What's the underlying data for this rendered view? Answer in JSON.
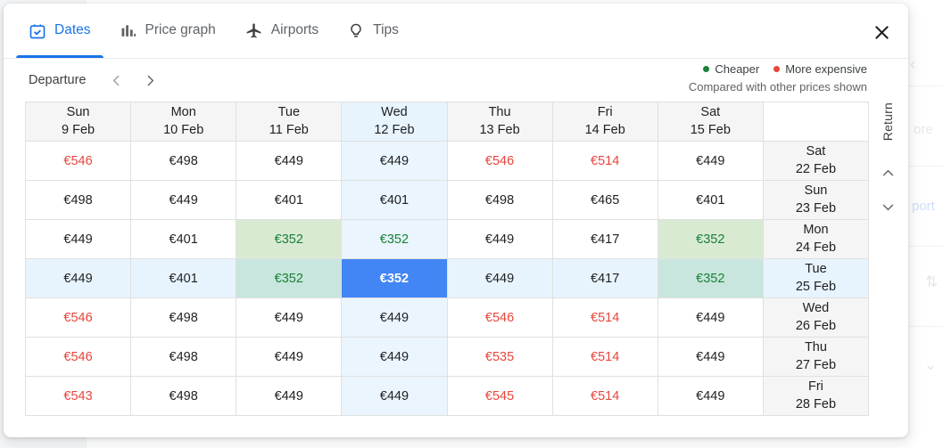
{
  "tabs": [
    {
      "label": "Dates",
      "icon": "calendar-check-icon",
      "active": true
    },
    {
      "label": "Price graph",
      "icon": "bar-chart-icon",
      "active": false
    },
    {
      "label": "Airports",
      "icon": "airplane-icon",
      "active": false
    },
    {
      "label": "Tips",
      "icon": "lightbulb-icon",
      "active": false
    }
  ],
  "close_label": "✕",
  "subheader": {
    "departure_label": "Departure",
    "prev_label": "‹",
    "next_label": "›"
  },
  "legend": {
    "cheaper_label": "Cheaper",
    "expensive_label": "More expensive",
    "note": "Compared with other prices shown",
    "cheaper_color": "#188038",
    "expensive_color": "#e8453c"
  },
  "return_rail": {
    "label": "Return",
    "up_label": "⌃",
    "down_label": "⌄"
  },
  "grid": {
    "corner_label": "",
    "columns": [
      {
        "day": "Sun",
        "date": "9 Feb",
        "highlight": false
      },
      {
        "day": "Mon",
        "date": "10 Feb",
        "highlight": false
      },
      {
        "day": "Tue",
        "date": "11 Feb",
        "highlight": false
      },
      {
        "day": "Wed",
        "date": "12 Feb",
        "highlight": true
      },
      {
        "day": "Thu",
        "date": "13 Feb",
        "highlight": false
      },
      {
        "day": "Fri",
        "date": "14 Feb",
        "highlight": false
      },
      {
        "day": "Sat",
        "date": "15 Feb",
        "highlight": false
      }
    ],
    "rows": [
      {
        "day": "Sat",
        "date": "22 Feb",
        "highlight": false,
        "cells": [
          {
            "price": "€546",
            "state": "high"
          },
          {
            "price": "€498",
            "state": "normal"
          },
          {
            "price": "€449",
            "state": "normal"
          },
          {
            "price": "€449",
            "state": "normal"
          },
          {
            "price": "€546",
            "state": "high"
          },
          {
            "price": "€514",
            "state": "high"
          },
          {
            "price": "€449",
            "state": "normal"
          }
        ]
      },
      {
        "day": "Sun",
        "date": "23 Feb",
        "highlight": false,
        "cells": [
          {
            "price": "€498",
            "state": "normal"
          },
          {
            "price": "€449",
            "state": "normal"
          },
          {
            "price": "€401",
            "state": "normal"
          },
          {
            "price": "€401",
            "state": "normal"
          },
          {
            "price": "€498",
            "state": "normal"
          },
          {
            "price": "€465",
            "state": "normal"
          },
          {
            "price": "€401",
            "state": "normal"
          }
        ]
      },
      {
        "day": "Mon",
        "date": "24 Feb",
        "highlight": false,
        "cells": [
          {
            "price": "€449",
            "state": "normal"
          },
          {
            "price": "€401",
            "state": "normal"
          },
          {
            "price": "€352",
            "state": "low"
          },
          {
            "price": "€352",
            "state": "low"
          },
          {
            "price": "€449",
            "state": "normal"
          },
          {
            "price": "€417",
            "state": "normal"
          },
          {
            "price": "€352",
            "state": "low"
          }
        ]
      },
      {
        "day": "Tue",
        "date": "25 Feb",
        "highlight": true,
        "cells": [
          {
            "price": "€449",
            "state": "normal"
          },
          {
            "price": "€401",
            "state": "normal"
          },
          {
            "price": "€352",
            "state": "low"
          },
          {
            "price": "€352",
            "state": "selected"
          },
          {
            "price": "€449",
            "state": "normal"
          },
          {
            "price": "€417",
            "state": "normal"
          },
          {
            "price": "€352",
            "state": "low"
          }
        ]
      },
      {
        "day": "Wed",
        "date": "26 Feb",
        "highlight": false,
        "cells": [
          {
            "price": "€546",
            "state": "high"
          },
          {
            "price": "€498",
            "state": "normal"
          },
          {
            "price": "€449",
            "state": "normal"
          },
          {
            "price": "€449",
            "state": "normal"
          },
          {
            "price": "€546",
            "state": "high"
          },
          {
            "price": "€514",
            "state": "high"
          },
          {
            "price": "€449",
            "state": "normal"
          }
        ]
      },
      {
        "day": "Thu",
        "date": "27 Feb",
        "highlight": false,
        "cells": [
          {
            "price": "€546",
            "state": "high"
          },
          {
            "price": "€498",
            "state": "normal"
          },
          {
            "price": "€449",
            "state": "normal"
          },
          {
            "price": "€449",
            "state": "normal"
          },
          {
            "price": "€535",
            "state": "high"
          },
          {
            "price": "€514",
            "state": "high"
          },
          {
            "price": "€449",
            "state": "normal"
          }
        ]
      },
      {
        "day": "Fri",
        "date": "28 Feb",
        "highlight": false,
        "cells": [
          {
            "price": "€543",
            "state": "high"
          },
          {
            "price": "€498",
            "state": "normal"
          },
          {
            "price": "€449",
            "state": "normal"
          },
          {
            "price": "€449",
            "state": "normal"
          },
          {
            "price": "€545",
            "state": "high"
          },
          {
            "price": "€514",
            "state": "high"
          },
          {
            "price": "€449",
            "state": "normal"
          }
        ]
      }
    ]
  },
  "background": {
    "chevron_left": "‹",
    "more_text": "ore",
    "port_text": "port",
    "swap_icon": "⇅",
    "chevron_down": "⌄"
  }
}
